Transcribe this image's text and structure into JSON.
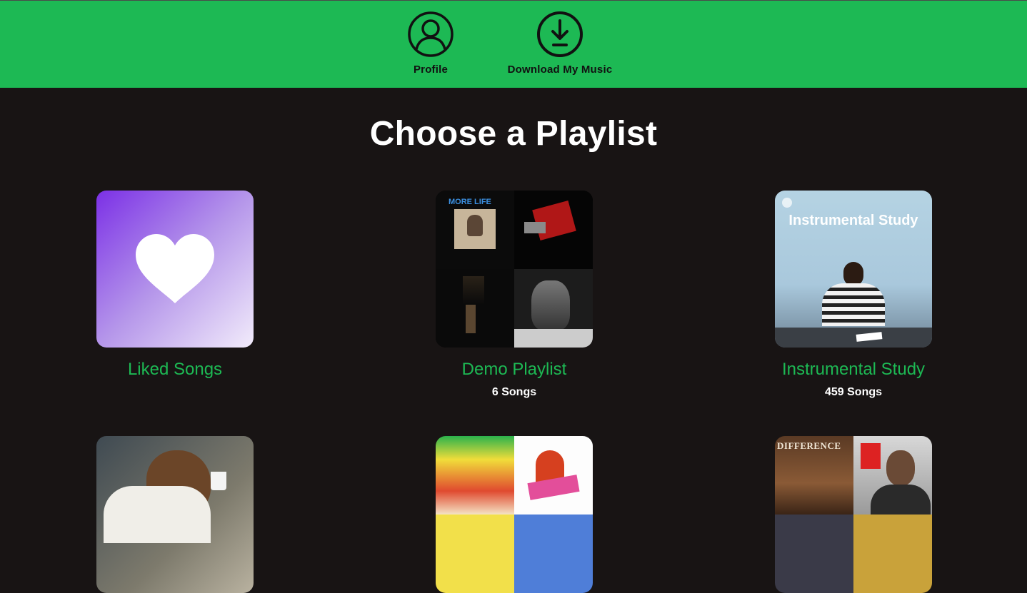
{
  "nav": {
    "profile": {
      "label": "Profile",
      "icon": "profile-icon"
    },
    "download": {
      "label": "Download My Music",
      "icon": "download-icon"
    }
  },
  "page": {
    "title": "Choose a Playlist"
  },
  "colors": {
    "accent": "#1db954",
    "background": "#181414",
    "text": "#ffffff"
  },
  "playlists": [
    {
      "name": "Liked Songs",
      "count": ""
    },
    {
      "name": "Demo Playlist",
      "count": "6 Songs",
      "cover_text": "MORE LIFE"
    },
    {
      "name": "Instrumental Study",
      "count": "459 Songs",
      "cover_text": "Instrumental Study"
    },
    {
      "name": "",
      "count": ""
    },
    {
      "name": "",
      "count": ""
    },
    {
      "name": "",
      "count": "",
      "cover_text": "DIFFERENCE"
    }
  ]
}
